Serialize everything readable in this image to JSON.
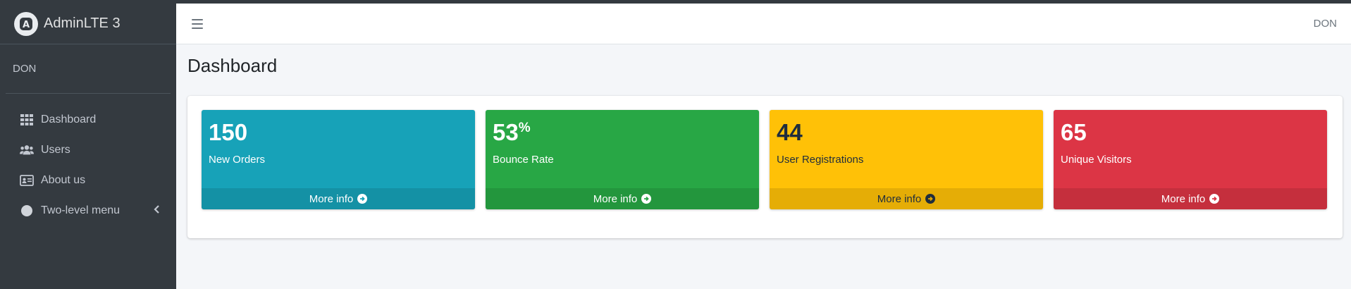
{
  "brand": {
    "title": "AdminLTE 3",
    "logo_icon": "adminlte-logo-icon"
  },
  "sidebar": {
    "user": "DON",
    "items": [
      {
        "label": "Dashboard",
        "icon": "grid-icon"
      },
      {
        "label": "Users",
        "icon": "users-icon"
      },
      {
        "label": "About us",
        "icon": "id-card-icon"
      },
      {
        "label": "Two-level menu",
        "icon": "circle-icon",
        "expand_icon": "chevron-left-icon"
      }
    ]
  },
  "header": {
    "menu_icon": "hamburger-icon",
    "user": "DON"
  },
  "main": {
    "title": "Dashboard",
    "boxes": [
      {
        "value": "150",
        "suffix": "",
        "label": "New Orders",
        "footer": "More info",
        "color": "#17a2b8"
      },
      {
        "value": "53",
        "suffix": "%",
        "label": "Bounce Rate",
        "footer": "More info",
        "color": "#28a745"
      },
      {
        "value": "44",
        "suffix": "",
        "label": "User Registrations",
        "footer": "More info",
        "color": "#ffc107"
      },
      {
        "value": "65",
        "suffix": "",
        "label": "Unique Visitors",
        "footer": "More info",
        "color": "#dc3545"
      }
    ]
  }
}
